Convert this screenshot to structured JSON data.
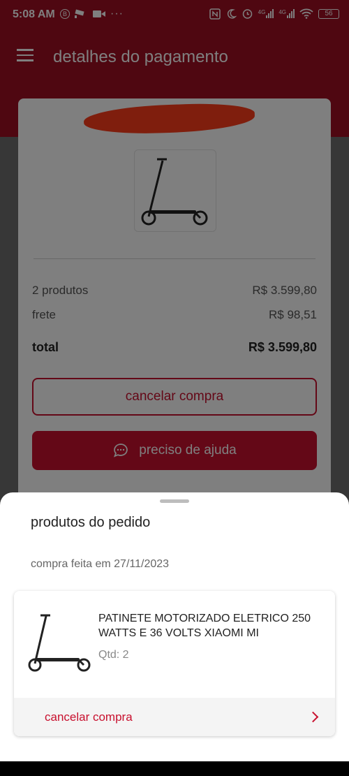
{
  "status_bar": {
    "time": "5:08 AM",
    "icons_left": [
      "b-circle-icon",
      "cctv-icon",
      "video-icon",
      "more-dots-icon"
    ],
    "more": "···",
    "network": "4G",
    "network2": "4G",
    "battery": "56"
  },
  "header": {
    "title": "detalhes do pagamento"
  },
  "summary": {
    "products_label": "2 produtos",
    "products_value": "R$ 3.599,80",
    "shipping_label": "frete",
    "shipping_value": "R$ 98,51",
    "total_label": "total",
    "total_value": "R$ 3.599,80",
    "cancel_button": "cancelar compra",
    "help_button": "preciso de ajuda"
  },
  "sheet": {
    "title": "produtos do pedido",
    "order_date": "compra feita em 27/11/2023",
    "item": {
      "name": "PATINETE MOTORIZADO ELETRICO 250 WATTS E 36 VOLTS XIAOMI MI",
      "qty": "Qtd: 2",
      "cancel_link": "cancelar compra"
    }
  },
  "colors": {
    "brand": "#c8102e",
    "header": "#9e0f22"
  }
}
